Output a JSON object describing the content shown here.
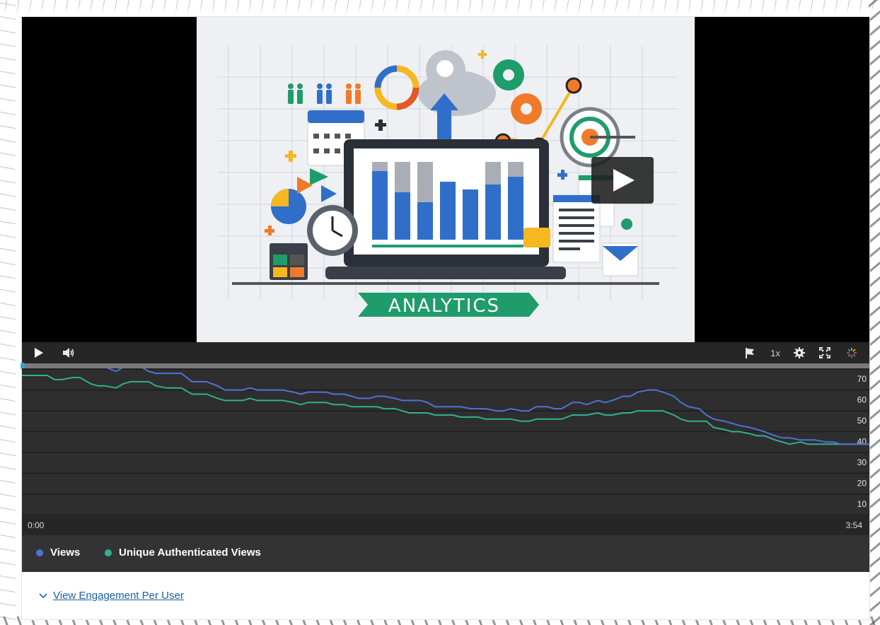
{
  "player": {
    "thumbnail_caption": "ANALYTICS",
    "controls": {
      "play_icon": "play-icon",
      "volume_icon": "volume-icon",
      "flag_icon": "flag-icon",
      "speed": "1x",
      "settings_icon": "gear-icon",
      "fullscreen_icon": "fullscreen-icon",
      "brand_icon": "kaltura-burst-icon"
    },
    "progress_fraction": 0.0
  },
  "chart": {
    "time_start": "0:00",
    "time_end": "3:54"
  },
  "chart_data": {
    "type": "line",
    "title": "",
    "xlabel": "",
    "ylabel": "",
    "x_range_seconds": [
      0,
      234
    ],
    "ylim": [
      5,
      75
    ],
    "yticks": [
      10,
      20,
      30,
      40,
      50,
      60,
      70
    ],
    "ytick_labels": [
      "10",
      "20",
      "30",
      "40",
      "50",
      "60",
      "70"
    ],
    "grid": true,
    "legend": "bottom",
    "x_seconds": [
      0,
      4,
      7,
      9,
      11,
      14,
      16,
      19,
      21,
      23,
      26,
      28,
      30,
      33,
      35,
      37,
      40,
      42,
      44,
      47,
      49,
      51,
      54,
      56,
      58,
      61,
      63,
      65,
      68,
      70,
      72,
      75,
      77,
      79,
      82,
      84,
      86,
      89,
      91,
      93,
      96,
      98,
      100,
      103,
      105,
      107,
      110,
      112,
      114,
      117,
      119,
      121,
      124,
      126,
      128,
      131,
      133,
      135,
      138,
      140,
      142,
      145,
      147,
      149,
      152,
      154,
      156,
      159,
      161,
      163,
      166,
      168,
      170,
      173,
      175,
      177,
      180,
      182,
      184,
      187,
      189,
      191,
      194,
      196,
      198,
      201,
      203,
      205,
      208,
      210,
      212,
      215,
      217,
      219,
      222,
      224,
      226,
      229,
      231,
      234
    ],
    "series": [
      {
        "name": "Views",
        "color": "#4f72d8",
        "values": [
          73,
          73,
          75,
          74,
          74,
          76,
          75,
          72,
          71,
          71,
          69,
          71,
          72,
          71,
          69,
          68,
          68,
          68,
          68,
          64,
          64,
          64,
          62,
          60,
          60,
          60,
          61,
          60,
          60,
          60,
          60,
          59,
          58,
          59,
          59,
          59,
          58,
          58,
          57,
          56,
          56,
          57,
          57,
          56,
          55,
          55,
          55,
          54,
          52,
          52,
          52,
          52,
          51,
          51,
          51,
          50,
          50,
          51,
          50,
          50,
          52,
          52,
          51,
          51,
          54,
          54,
          53,
          55,
          54,
          55,
          57,
          57,
          59,
          60,
          60,
          59,
          57,
          54,
          52,
          51,
          48,
          46,
          45,
          44,
          43,
          42,
          41,
          40,
          38,
          37,
          37,
          36,
          36,
          36,
          35,
          35,
          34,
          34,
          34,
          34
        ]
      },
      {
        "name": "Unique Authenticated Views",
        "color": "#2fb08f",
        "values": [
          67,
          67,
          67,
          65,
          65,
          66,
          66,
          63,
          62,
          62,
          61,
          63,
          64,
          64,
          64,
          62,
          61,
          61,
          61,
          58,
          58,
          58,
          56,
          55,
          55,
          55,
          56,
          55,
          55,
          55,
          55,
          54,
          53,
          54,
          54,
          54,
          53,
          53,
          52,
          52,
          52,
          52,
          51,
          51,
          50,
          49,
          49,
          49,
          48,
          48,
          48,
          47,
          47,
          47,
          46,
          46,
          46,
          46,
          45,
          45,
          46,
          46,
          46,
          46,
          48,
          48,
          48,
          49,
          48,
          48,
          49,
          49,
          50,
          50,
          50,
          50,
          48,
          46,
          45,
          45,
          45,
          42,
          41,
          40,
          40,
          39,
          38,
          38,
          36,
          35,
          34,
          35,
          34,
          34,
          34,
          34,
          34,
          34,
          34,
          34
        ]
      }
    ]
  },
  "legend": {
    "views_label": "Views",
    "unique_label": "Unique Authenticated Views",
    "views_color": "#4f72d8",
    "unique_color": "#2fb08f"
  },
  "engagement": {
    "label": "View Engagement Per User",
    "icon": "chevron-down-icon"
  }
}
